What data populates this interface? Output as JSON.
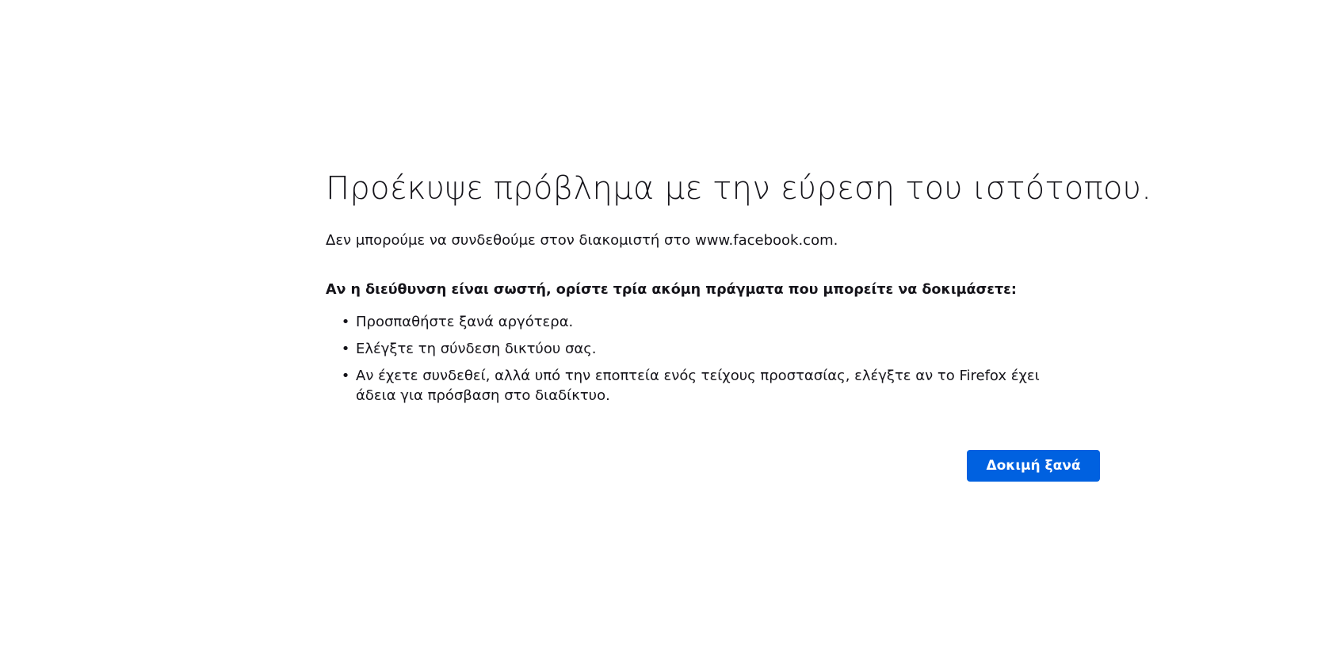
{
  "error": {
    "title": "Προέκυψε πρόβλημα με την εύρεση του ιστότοπου.",
    "short_description": "Δεν μπορούμε να συνδεθούμε στον διακομιστή στο www.facebook.com.",
    "advice_heading": "Αν η διεύθυνση είναι σωστή, ορίστε τρία ακόμη πράγματα που μπορείτε να δοκιμάσετε:",
    "advice_items": [
      "Προσπαθήστε ξανά αργότερα.",
      "Ελέγξτε τη σύνδεση δικτύου σας.",
      "Αν έχετε συνδεθεί, αλλά υπό την εποπτεία ενός τείχους προστασίας, ελέγξτε αν το Firefox έχει άδεια για πρόσβαση στο διαδίκτυο."
    ],
    "bullet": "•",
    "try_again_label": "Δοκιμή ξανά"
  },
  "colors": {
    "background": "#ffffff",
    "text": "#15141a",
    "primary_button": "#0061e0",
    "primary_button_text": "#ffffff"
  }
}
